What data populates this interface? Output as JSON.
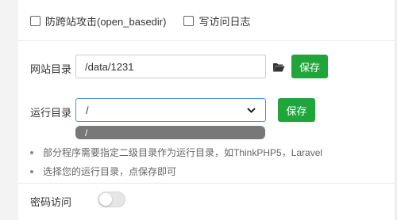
{
  "options": {
    "anti_cross_site": "防跨站攻击(open_basedir)",
    "access_log": "写访问日志"
  },
  "site_dir": {
    "label": "网站目录",
    "value": "/data/1231",
    "save_label": "保存"
  },
  "run_dir": {
    "label": "运行目录",
    "selected": "/",
    "options": [
      "/"
    ],
    "save_label": "保存"
  },
  "tips": [
    "部分程序需要指定二级目录作为运行目录，如ThinkPHP5，Laravel",
    "选择您的运行目录，点保存即可"
  ],
  "password_access": {
    "label": "密码访问",
    "enabled": false
  },
  "colors": {
    "accent_green": "#20a53a",
    "focus_blue": "#4a90e2"
  }
}
